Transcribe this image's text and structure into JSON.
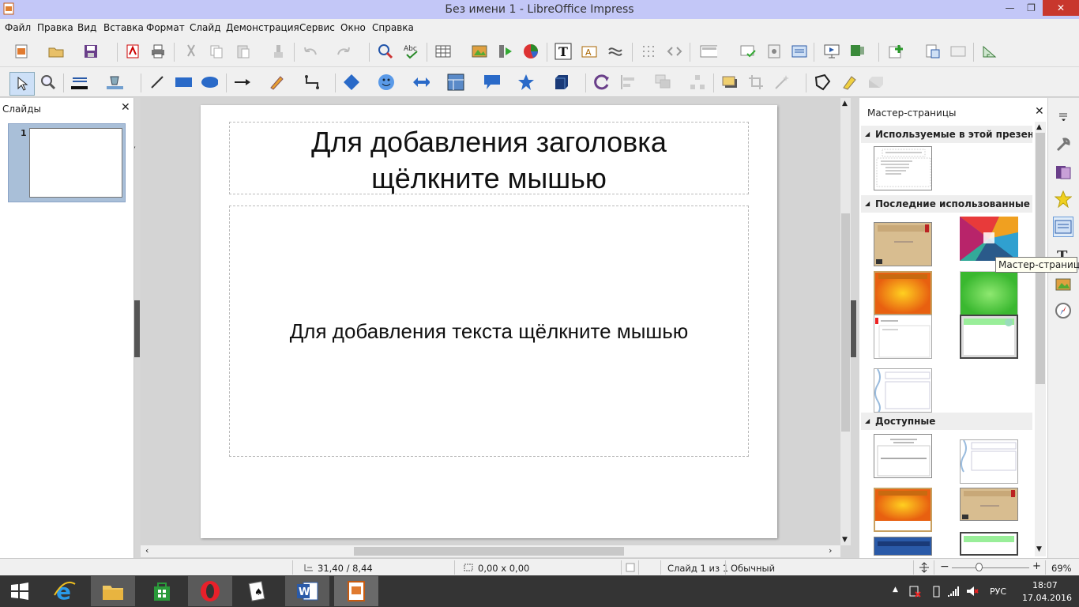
{
  "window": {
    "title": "Без имени 1 - LibreOffice Impress",
    "minimize": "—",
    "restore": "❐",
    "close": "✕"
  },
  "menu": [
    "Файл",
    "Правка",
    "Вид",
    "Вставка",
    "Формат",
    "Слайд",
    "Демонстрация",
    "Сервис",
    "Окно",
    "Справка"
  ],
  "slides_pane": {
    "title": "Слайды",
    "close": "✕",
    "thumb_number": "1"
  },
  "slide": {
    "title_placeholder_line1": "Для добавления заголовка",
    "title_placeholder_line2": "щёлкните мышью",
    "body_placeholder": "Для добавления текста щёлкните мышью"
  },
  "master_pages": {
    "title": "Мастер-страницы",
    "close": "✕",
    "sections": {
      "used": "Используемые в этой презентации",
      "recent": "Последние использованные",
      "available": "Доступные"
    },
    "tooltip": "Мастер-страницы"
  },
  "status": {
    "position": "31,40 / 8,44",
    "size": "0,00 x 0,00",
    "slide": "Слайд 1 из 1",
    "layout": "Обычный",
    "zoom": "69%",
    "zoom_fraction": 0.69
  },
  "taskbar": {
    "language": "РУС",
    "time": "18:07",
    "date": "17.04.2016"
  },
  "colors": {
    "titlebar": "#c3c7f7",
    "close_button": "#c8372d",
    "thumb_selected": "#a9bfd8",
    "taskbar": "#343434"
  }
}
